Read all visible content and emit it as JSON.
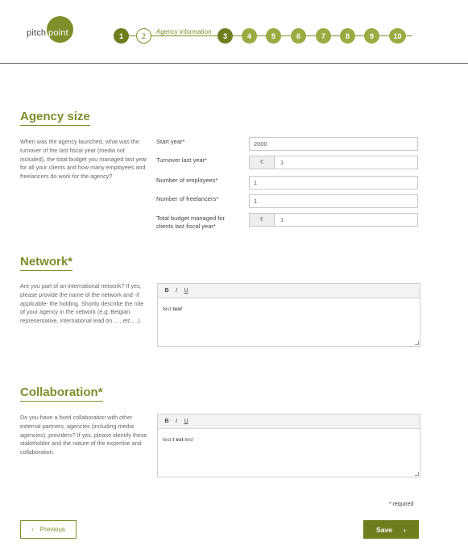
{
  "header": {
    "logo": {
      "text_left": "pitch",
      "text_right": "point"
    },
    "steps": [
      "1",
      "2",
      "3",
      "4",
      "5",
      "6",
      "7",
      "8",
      "9",
      "10"
    ],
    "current_step_label": "Agency information"
  },
  "agency_size": {
    "title": "Agency size",
    "description": "When was the agency launched, what was the turnover of the last fiscal year (media not included), the total budget you managed last year for all your clients and how many employees and freelancers do work for the agency?",
    "fields": {
      "start_year": {
        "label": "Start year*",
        "value": "2000"
      },
      "turnover": {
        "label": "Turnover last year*",
        "currency": "€",
        "value": "1"
      },
      "employees": {
        "label": "Number of employees*",
        "value": "1"
      },
      "freelancers": {
        "label": "Number of freelancers*",
        "value": "1"
      },
      "budget": {
        "label": "Total budget managed for clients last fiscal year*",
        "currency": "€",
        "value": "1"
      }
    }
  },
  "network": {
    "title": "Network*",
    "description": "Are you part of an international network? If yes, please provide the name of the network and -if applicable- the holding. Shortly describe the role of your agency in the network (e.g. Belgian representative, international lead on …, etc….).",
    "toolbar": {
      "bold": "B",
      "italic": "I",
      "underline": "U"
    },
    "content_plain": "test",
    "content_styled": "test"
  },
  "collaboration": {
    "title": "Collaboration*",
    "description": "Do you have a fixed collaboration with other external partners, agencies (including media agencies), providers? If yes, please identify these stakeholder and the nature of the expertise and collaboration.",
    "toolbar": {
      "bold": "B",
      "italic": "I",
      "underline": "U"
    },
    "content_a": "test",
    "content_b": "t est",
    "content_c": "test"
  },
  "footer": {
    "required_note": "* required",
    "prev_label": "Previous",
    "prev_icon": "‹",
    "save_label": "Save",
    "save_icon": "›"
  },
  "colors": {
    "brand": "#7f8d2a",
    "brand_dark": "#6f7d1f",
    "brand_light": "#9aab42"
  }
}
